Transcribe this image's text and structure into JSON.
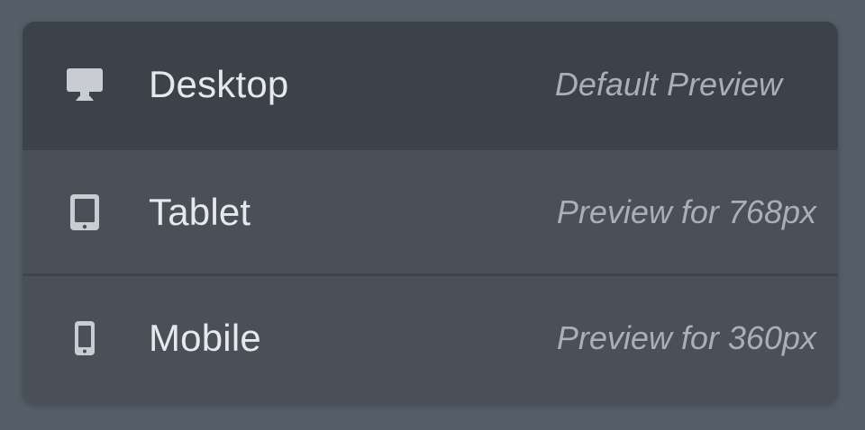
{
  "menu": {
    "items": [
      {
        "label": "Desktop",
        "description": "Default Preview",
        "icon": "desktop-icon",
        "active": true
      },
      {
        "label": "Tablet",
        "description": "Preview for 768px",
        "icon": "tablet-icon",
        "active": false
      },
      {
        "label": "Mobile",
        "description": "Preview for 360px",
        "icon": "mobile-icon",
        "active": false
      }
    ]
  },
  "colors": {
    "background": "#565f69",
    "menu": "#495058",
    "active_row": "#3c4249",
    "label": "#e6e8ea",
    "description": "#a9afb6",
    "icon": "#c9cdd2"
  }
}
